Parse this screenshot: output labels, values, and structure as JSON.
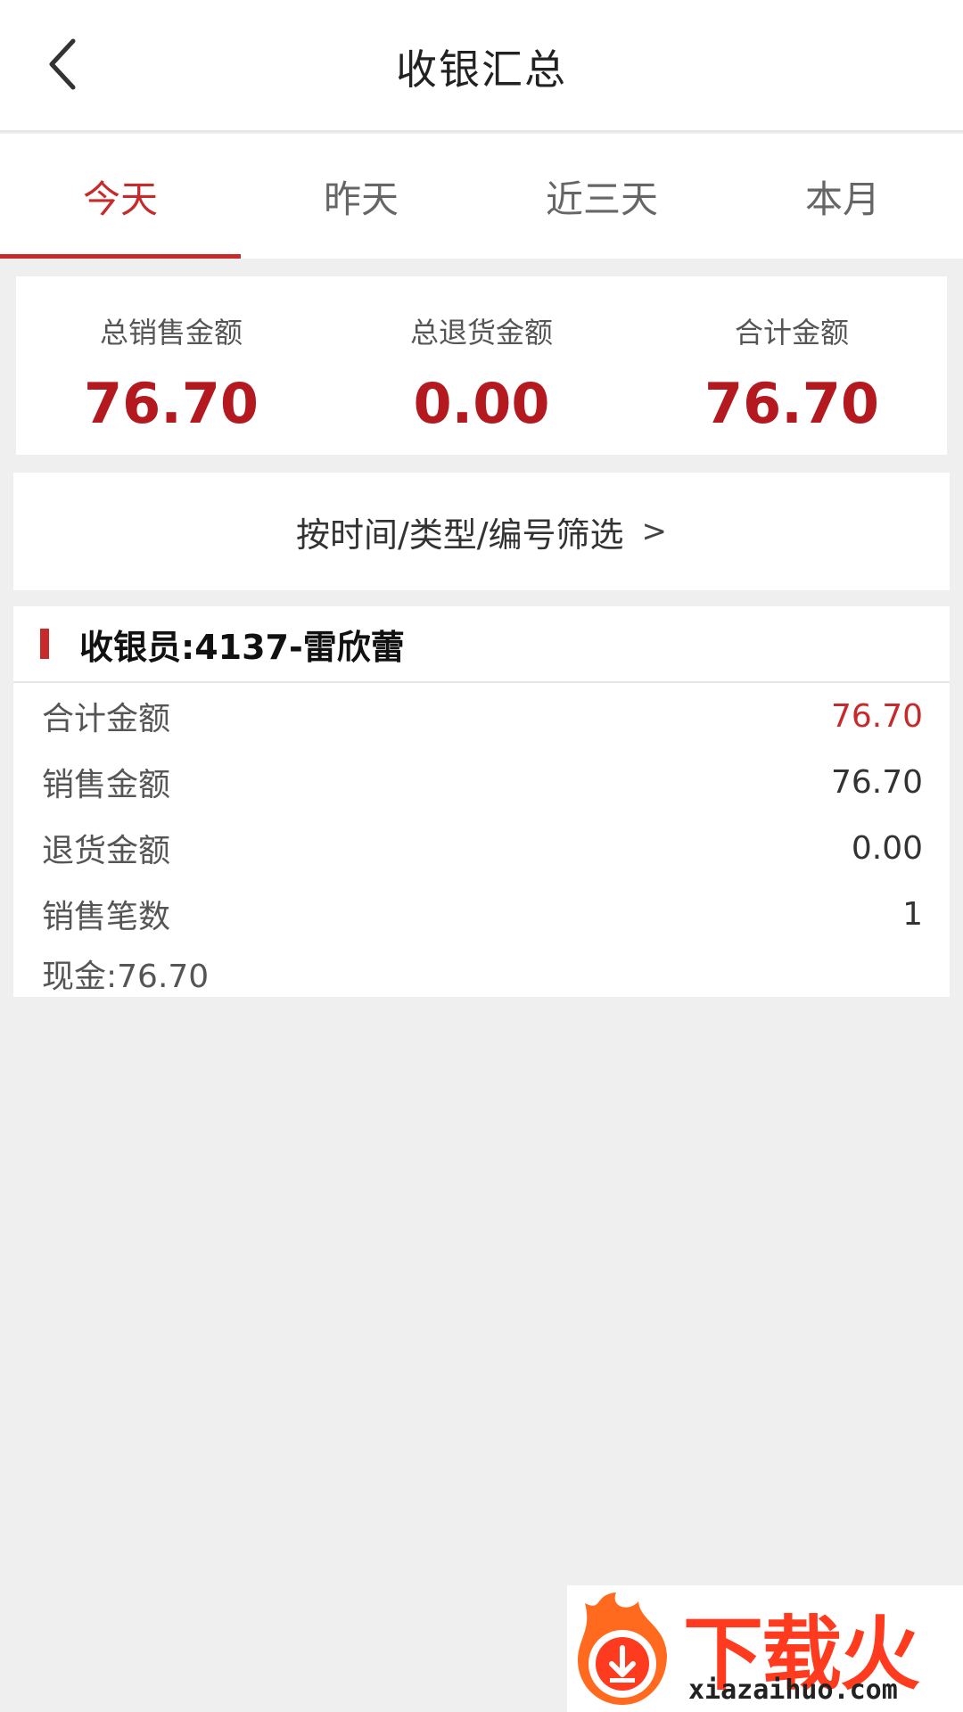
{
  "header": {
    "title": "收银汇总",
    "back_icon": "chevron-left-icon"
  },
  "tabs": [
    {
      "label": "今天",
      "active": true
    },
    {
      "label": "昨天",
      "active": false
    },
    {
      "label": "近三天",
      "active": false
    },
    {
      "label": "本月",
      "active": false
    }
  ],
  "summary": {
    "total_sales_label": "总销售金额",
    "total_sales_value": "76.70",
    "total_return_label": "总退货金额",
    "total_return_value": "0.00",
    "grand_total_label": "合计金额",
    "grand_total_value": "76.70"
  },
  "filter": {
    "label": "按时间/类型/编号筛选",
    "arrow": ">"
  },
  "cashier": {
    "title": "收银员:4137-雷欣蕾",
    "rows": [
      {
        "label": "合计金额",
        "value": "76.70"
      },
      {
        "label": "销售金额",
        "value": "76.70"
      },
      {
        "label": "退货金额",
        "value": "0.00"
      },
      {
        "label": "销售笔数",
        "value": "1"
      }
    ],
    "cash_line": "现金:76.70"
  },
  "watermark": {
    "logo_text": "下载火",
    "url": "xiazaihuo.com"
  },
  "colors": {
    "accent": "#c62a2a",
    "value_red": "#b3191f",
    "background": "#efefef"
  }
}
